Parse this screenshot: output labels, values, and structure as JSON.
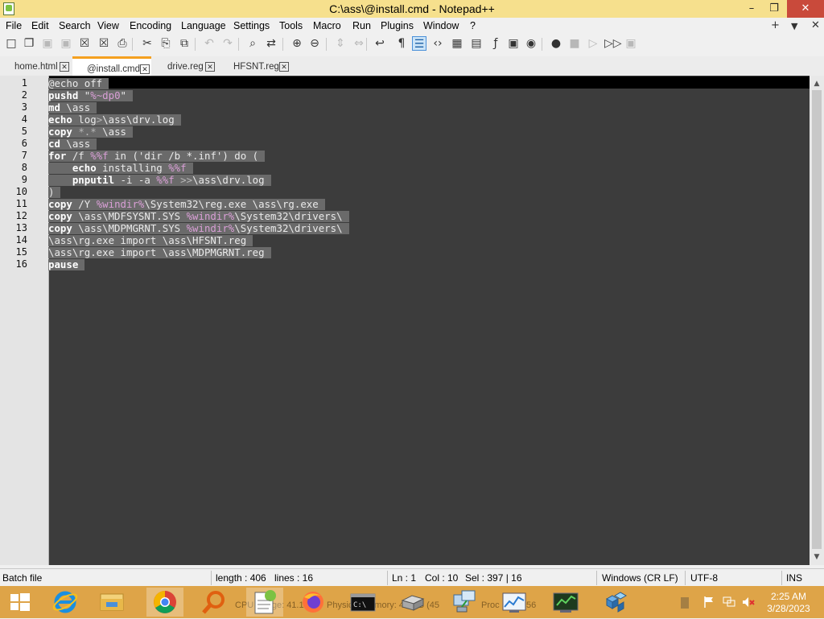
{
  "window": {
    "title": "C:\\ass\\@install.cmd - Notepad++",
    "controls": {
      "minimize": "–",
      "restore": "❐",
      "close": "✕"
    },
    "icon": "notepad-plus-plus-icon"
  },
  "menu": [
    "File",
    "Edit",
    "Search",
    "View",
    "Encoding",
    "Language",
    "Settings",
    "Tools",
    "Macro",
    "Run",
    "Plugins",
    "Window",
    "?"
  ],
  "menu_right": {
    "add": "+",
    "dropdown": "▼",
    "close": "✕"
  },
  "toolbar": [
    {
      "name": "new-file-icon",
      "glyph": "□",
      "state": "normal"
    },
    {
      "name": "open-file-icon",
      "glyph": "❐",
      "state": "normal"
    },
    {
      "name": "save-icon",
      "glyph": "▣",
      "state": "dim"
    },
    {
      "name": "save-all-icon",
      "glyph": "▣",
      "state": "dim"
    },
    {
      "name": "close-file-icon",
      "glyph": "☒",
      "state": "normal"
    },
    {
      "name": "close-all-icon",
      "glyph": "☒",
      "state": "normal"
    },
    {
      "name": "print-icon",
      "glyph": "⎙",
      "state": "normal"
    },
    {
      "name": "cut-icon",
      "glyph": "✂",
      "state": "normal"
    },
    {
      "name": "copy-icon",
      "glyph": "⎘",
      "state": "normal"
    },
    {
      "name": "paste-icon",
      "glyph": "⧉",
      "state": "normal"
    },
    {
      "name": "undo-icon",
      "glyph": "↶",
      "state": "dim"
    },
    {
      "name": "redo-icon",
      "glyph": "↷",
      "state": "dim"
    },
    {
      "name": "find-icon",
      "glyph": "⌕",
      "state": "normal"
    },
    {
      "name": "replace-icon",
      "glyph": "⇄",
      "state": "normal"
    },
    {
      "name": "zoom-in-icon",
      "glyph": "⊕",
      "state": "normal"
    },
    {
      "name": "zoom-out-icon",
      "glyph": "⊖",
      "state": "normal"
    },
    {
      "name": "sync-vertical-icon",
      "glyph": "⇕",
      "state": "dim"
    },
    {
      "name": "sync-horizontal-icon",
      "glyph": "⇔",
      "state": "dim"
    },
    {
      "name": "word-wrap-icon",
      "glyph": "↩",
      "state": "normal"
    },
    {
      "name": "show-all-chars-icon",
      "glyph": "¶",
      "state": "normal"
    },
    {
      "name": "indent-guide-icon",
      "glyph": "☰",
      "state": "active"
    },
    {
      "name": "xml-tag-icon",
      "glyph": "‹›",
      "state": "normal"
    },
    {
      "name": "document-map-icon",
      "glyph": "▦",
      "state": "normal"
    },
    {
      "name": "document-list-icon",
      "glyph": "▤",
      "state": "normal"
    },
    {
      "name": "function-list-icon",
      "glyph": "ƒ",
      "state": "normal"
    },
    {
      "name": "folder-workspace-icon",
      "glyph": "▣",
      "state": "normal"
    },
    {
      "name": "monitoring-icon",
      "glyph": "◉",
      "state": "normal"
    },
    {
      "name": "record-macro-icon",
      "glyph": "●",
      "state": "normal"
    },
    {
      "name": "stop-macro-icon",
      "glyph": "■",
      "state": "dim"
    },
    {
      "name": "play-macro-icon",
      "glyph": "▷",
      "state": "dim"
    },
    {
      "name": "run-macro-multiple-icon",
      "glyph": "▷▷",
      "state": "normal"
    },
    {
      "name": "save-macro-icon",
      "glyph": "▣",
      "state": "dim"
    }
  ],
  "tabs": [
    {
      "label": "home.html",
      "active": false
    },
    {
      "label": "@install.cmd",
      "active": true
    },
    {
      "label": "drive.reg",
      "active": false
    },
    {
      "label": "HFSNT.reg",
      "active": false
    }
  ],
  "tab_close_glyph": "✕",
  "code_lines": [
    {
      "n": "1",
      "t": "@echo off"
    },
    {
      "n": "2",
      "t": "pushd \"%~dp0\""
    },
    {
      "n": "3",
      "t": "md \\ass"
    },
    {
      "n": "4",
      "t": "echo log>\\ass\\drv.log"
    },
    {
      "n": "5",
      "t": "copy *.* \\ass"
    },
    {
      "n": "6",
      "t": "cd \\ass"
    },
    {
      "n": "7",
      "t": "for /f %%f in ('dir /b *.inf') do ("
    },
    {
      "n": "8",
      "t": "    echo installing %%f"
    },
    {
      "n": "9",
      "t": "    pnputil -i -a %%f >>\\ass\\drv.log"
    },
    {
      "n": "10",
      "t": ")"
    },
    {
      "n": "11",
      "t": "copy /Y %windir%\\System32\\reg.exe \\ass\\rg.exe"
    },
    {
      "n": "12",
      "t": "copy \\ass\\MDFSYSNT.SYS %windir%\\System32\\drivers\\"
    },
    {
      "n": "13",
      "t": "copy \\ass\\MDPMGRNT.SYS %windir%\\System32\\drivers\\"
    },
    {
      "n": "14",
      "t": "\\ass\\rg.exe import \\ass\\HFSNT.reg"
    },
    {
      "n": "15",
      "t": "\\ass\\rg.exe import \\ass\\MDPMGRNT.reg"
    },
    {
      "n": "16",
      "t": "pause"
    }
  ],
  "scrollbar": {
    "up": "▲",
    "down": "▼"
  },
  "status": {
    "filetype": "Batch file",
    "length": "length : 406",
    "lines": "lines : 16",
    "ln": "Ln : 1",
    "col": "Col : 10",
    "sel": "Sel : 397 | 16",
    "eol": "Windows (CR LF)",
    "encoding": "UTF-8",
    "mode": "INS"
  },
  "taskbar": {
    "apps": [
      {
        "name": "start-button",
        "icon": "windows-logo-icon"
      },
      {
        "name": "taskbar-ie",
        "icon": "internet-explorer-icon"
      },
      {
        "name": "taskbar-explorer",
        "icon": "file-explorer-icon"
      },
      {
        "name": "taskbar-chrome",
        "icon": "chrome-icon"
      },
      {
        "name": "taskbar-search",
        "icon": "magnifier-icon"
      },
      {
        "name": "taskbar-notepadpp",
        "icon": "notepad-plus-plus-icon"
      },
      {
        "name": "taskbar-firefox",
        "icon": "firefox-icon"
      },
      {
        "name": "taskbar-cmd",
        "icon": "command-prompt-icon"
      },
      {
        "name": "taskbar-drive",
        "icon": "disk-drive-icon"
      },
      {
        "name": "taskbar-network",
        "icon": "network-computer-icon"
      },
      {
        "name": "taskbar-perfmon",
        "icon": "performance-monitor-icon"
      },
      {
        "name": "taskbar-console",
        "icon": "console-icon"
      },
      {
        "name": "taskbar-regedit",
        "icon": "registry-editor-icon"
      }
    ],
    "ghost_text": [
      {
        "t": "CPU Usage: 41.1"
      },
      {
        "t": "Physical Memory: 45 GB (45"
      },
      {
        "t": "Proc"
      },
      {
        "t": "56"
      }
    ],
    "tray_icons": [
      "tray-arrow-icon",
      "flag-icon",
      "network-icon",
      "volume-muted-icon"
    ],
    "time": "2:25 AM",
    "date": "3/28/2023"
  },
  "colors": {
    "titlebar": "#f6e08d",
    "taskbar": "#dea448",
    "editor_bg": "#3c3c3c",
    "selection": "#6a6a6a",
    "active_tab_accent": "#f4a020",
    "variable": "#d99fd6"
  }
}
